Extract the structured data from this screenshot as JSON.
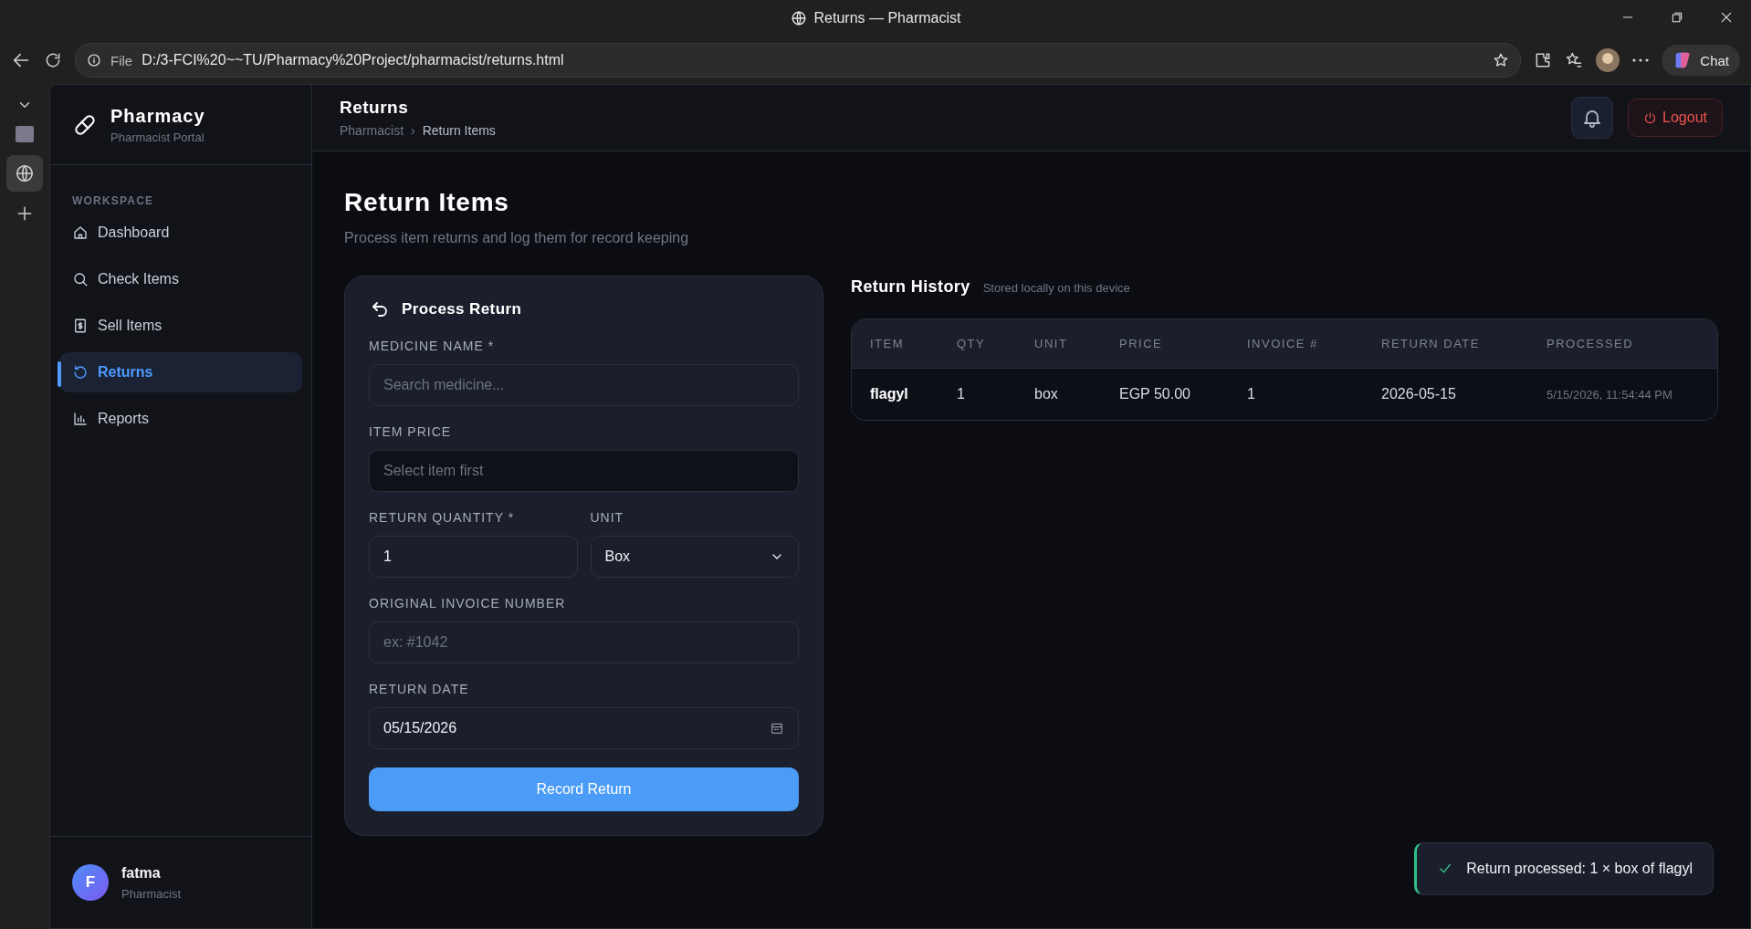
{
  "browser": {
    "tab_title": "Returns — Pharmacist",
    "url_label": "File",
    "url": "D:/3-FCI%20~~TU/Pharmacy%20Project/pharmacist/returns.html",
    "chat": "Chat"
  },
  "sidebar": {
    "brand": "Pharmacy",
    "subtitle": "Pharmacist Portal",
    "section": "WORKSPACE",
    "items": [
      {
        "label": "Dashboard",
        "selected": false
      },
      {
        "label": "Check Items",
        "selected": false
      },
      {
        "label": "Sell Items",
        "selected": false
      },
      {
        "label": "Returns",
        "selected": true
      },
      {
        "label": "Reports",
        "selected": false
      }
    ],
    "user": {
      "initial": "F",
      "name": "fatma",
      "role": "Pharmacist"
    }
  },
  "header": {
    "title": "Returns",
    "breadcrumb": [
      "Pharmacist",
      "Return Items"
    ],
    "separator": "›",
    "logout": "Logout"
  },
  "page": {
    "title": "Return Items",
    "subtitle": "Process item returns and log them for record keeping"
  },
  "form": {
    "title": "Process Return",
    "rows": [
      [
        {
          "label": "MEDICINE NAME *",
          "kind": "text",
          "placeholder": "Search medicine...",
          "disabled": false
        }
      ],
      [
        {
          "label": "ITEM PRICE",
          "kind": "text",
          "placeholder": "Select item first",
          "disabled": true
        }
      ],
      [
        {
          "label": "RETURN QUANTITY *",
          "kind": "text",
          "value": "1",
          "disabled": false
        },
        {
          "label": "UNIT",
          "kind": "select",
          "value": "Box",
          "disabled": false
        }
      ],
      [
        {
          "label": "ORIGINAL INVOICE NUMBER",
          "kind": "text",
          "placeholder": "ex: #1042",
          "disabled": false
        }
      ],
      [
        {
          "label": "RETURN DATE",
          "kind": "date",
          "value": "05/15/2026",
          "disabled": false
        }
      ]
    ],
    "button": "Record Return"
  },
  "history": {
    "title": "Return History",
    "note": "Stored locally on this device",
    "columns": [
      "ITEM",
      "QTY",
      "UNIT",
      "PRICE",
      "INVOICE #",
      "RETURN DATE",
      "PROCESSED"
    ],
    "rows": [
      [
        "flagyl",
        "1",
        "box",
        "EGP 50.00",
        "1",
        "2026-05-15",
        "5/15/2026, 11:54:44 PM"
      ]
    ]
  },
  "toast": {
    "text": "Return processed: 1 × box of flagyl"
  }
}
